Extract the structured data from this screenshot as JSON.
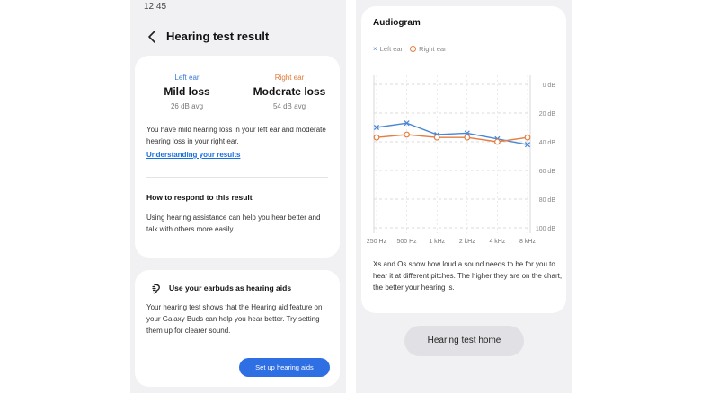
{
  "status": {
    "time": "12:45"
  },
  "header": {
    "title": "Hearing test result"
  },
  "results": {
    "left": {
      "label": "Left ear",
      "level": "Mild loss",
      "avg": "26 dB avg",
      "color": "#3a7bd5"
    },
    "right": {
      "label": "Right ear",
      "level": "Moderate loss",
      "avg": "54 dB avg",
      "color": "#e07b39"
    },
    "summary": "You have mild hearing loss in your left ear and moderate hearing loss in your right ear.",
    "link": "Understanding your results",
    "respond_title": "How to respond to this result",
    "respond_body": "Using hearing assistance can help you hear better and talk with others more easily."
  },
  "aids": {
    "icon": "earbud-icon",
    "title": "Use your earbuds as hearing aids",
    "body": "Your hearing test shows that the Hearing aid feature on your Galaxy Buds can help you hear better. Try setting them up for clearer sound.",
    "button": "Set up hearing aids"
  },
  "audiogram": {
    "title": "Audiogram",
    "note": "Xs and Os show how loud a sound needs to be for you to hear it at different pitches. The higher they are on the chart, the better your hearing is.",
    "home_button": "Hearing test home"
  },
  "chart_data": {
    "type": "line",
    "title": "Audiogram",
    "categories": [
      "250 Hz",
      "500 Hz",
      "1 kHz",
      "2 kHz",
      "4 kHz",
      "8 kHz"
    ],
    "y_ticks": [
      "0 dB",
      "20 dB",
      "40 dB",
      "60 dB",
      "80 dB",
      "100 dB"
    ],
    "ylim": [
      0,
      100
    ],
    "y_inverted": true,
    "grid": true,
    "legend_position": "top-left",
    "series": [
      {
        "name": "Left ear",
        "marker": "x",
        "color": "#4a86d6",
        "values": [
          30,
          27,
          35,
          34,
          38,
          42
        ]
      },
      {
        "name": "Right ear",
        "marker": "o",
        "color": "#e67e40",
        "values": [
          37,
          35,
          37,
          37,
          40,
          37
        ]
      }
    ]
  }
}
